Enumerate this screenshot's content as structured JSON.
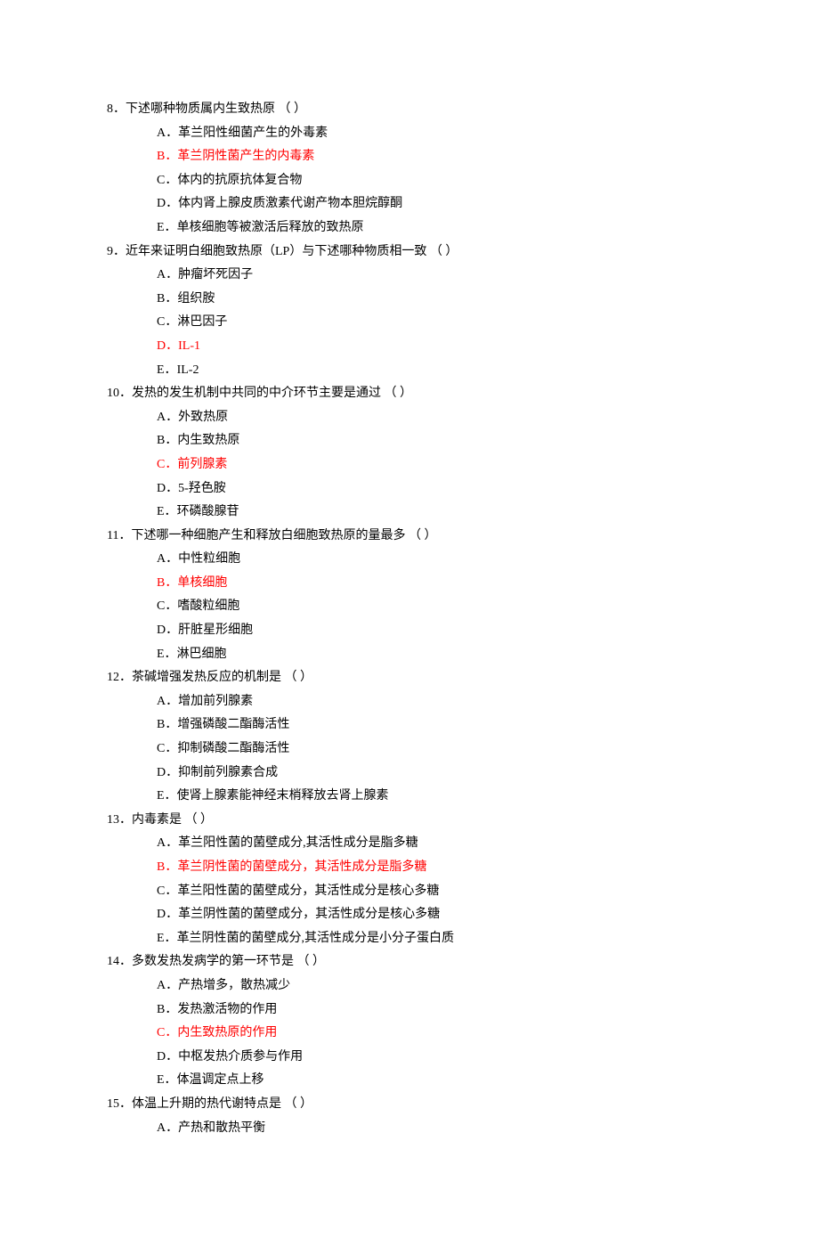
{
  "questions": [
    {
      "number": "8．",
      "stem": "下述哪种物质属内生致热原 （  ）",
      "options": [
        {
          "label": "A．",
          "text": "革兰阳性细菌产生的外毒素",
          "highlight": false
        },
        {
          "label": "B．",
          "text": "革兰阴性菌产生的内毒素",
          "highlight": true
        },
        {
          "label": "C．",
          "text": "体内的抗原抗体复合物",
          "highlight": false
        },
        {
          "label": "D．",
          "text": "体内肾上腺皮质激素代谢产物本胆烷醇酮",
          "highlight": false
        },
        {
          "label": "E．",
          "text": "单核细胞等被激活后释放的致热原",
          "highlight": false
        }
      ]
    },
    {
      "number": "9．",
      "stem": "近年来证明白细胞致热原（LP）与下述哪种物质相一致 （  ）",
      "options": [
        {
          "label": "A．",
          "text": "肿瘤坏死因子",
          "highlight": false
        },
        {
          "label": "B．",
          "text": "组织胺",
          "highlight": false
        },
        {
          "label": "C．",
          "text": "淋巴因子",
          "highlight": false
        },
        {
          "label": "D．",
          "text": "IL-1",
          "highlight": true
        },
        {
          "label": "E．",
          "text": "IL-2",
          "highlight": false
        }
      ]
    },
    {
      "number": "10．",
      "stem": "发热的发生机制中共同的中介环节主要是通过 （  ）",
      "options": [
        {
          "label": "A．",
          "text": "外致热原",
          "highlight": false
        },
        {
          "label": "B．",
          "text": "内生致热原",
          "highlight": false
        },
        {
          "label": "C．",
          "text": "前列腺素",
          "highlight": true
        },
        {
          "label": "D．",
          "text": "5-羟色胺",
          "highlight": false
        },
        {
          "label": "E．",
          "text": "环磷酸腺苷",
          "highlight": false
        }
      ]
    },
    {
      "number": "11．",
      "stem": "下述哪一种细胞产生和释放白细胞致热原的量最多 （  ）",
      "options": [
        {
          "label": "A．",
          "text": "中性粒细胞",
          "highlight": false
        },
        {
          "label": "B．",
          "text": "单核细胞",
          "highlight": true
        },
        {
          "label": "C．",
          "text": "嗜酸粒细胞",
          "highlight": false
        },
        {
          "label": "D．",
          "text": "肝脏星形细胞",
          "highlight": false
        },
        {
          "label": "E．",
          "text": "淋巴细胞",
          "highlight": false
        }
      ]
    },
    {
      "number": "12．",
      "stem": "茶碱增强发热反应的机制是 （  ）",
      "options": [
        {
          "label": "A．",
          "text": "增加前列腺素",
          "highlight": false
        },
        {
          "label": "B．",
          "text": "增强磷酸二酯酶活性",
          "highlight": false
        },
        {
          "label": "C．",
          "text": "抑制磷酸二酯酶活性",
          "highlight": false
        },
        {
          "label": "D．",
          "text": "抑制前列腺素合成",
          "highlight": false
        },
        {
          "label": "E．",
          "text": "使肾上腺素能神经末梢释放去肾上腺素",
          "highlight": false
        }
      ]
    },
    {
      "number": "13．",
      "stem": "内毒素是 （  ）",
      "options": [
        {
          "label": "A．",
          "text": "革兰阳性菌的菌壁成分,其活性成分是脂多糖",
          "highlight": false
        },
        {
          "label": "B．",
          "text": "革兰阴性菌的菌壁成分，其活性成分是脂多糖",
          "highlight": true
        },
        {
          "label": "C．",
          "text": "革兰阳性菌的菌壁成分，其活性成分是核心多糖",
          "highlight": false
        },
        {
          "label": "D．",
          "text": "革兰阴性菌的菌壁成分，其活性成分是核心多糖",
          "highlight": false
        },
        {
          "label": "E．",
          "text": "革兰阴性菌的菌壁成分,其活性成分是小分子蛋白质",
          "highlight": false
        }
      ]
    },
    {
      "number": "14．",
      "stem": "多数发热发病学的第一环节是 （  ）",
      "options": [
        {
          "label": "A．",
          "text": "产热增多，散热减少",
          "highlight": false
        },
        {
          "label": "B．",
          "text": "发热激活物的作用",
          "highlight": false
        },
        {
          "label": "C．",
          "text": "内生致热原的作用",
          "highlight": true
        },
        {
          "label": "D．",
          "text": "中枢发热介质参与作用",
          "highlight": false
        },
        {
          "label": "E．",
          "text": "体温调定点上移",
          "highlight": false
        }
      ]
    },
    {
      "number": "15．",
      "stem": "体温上升期的热代谢特点是 （  ）",
      "options": [
        {
          "label": "A．",
          "text": "产热和散热平衡",
          "highlight": false
        }
      ]
    }
  ]
}
